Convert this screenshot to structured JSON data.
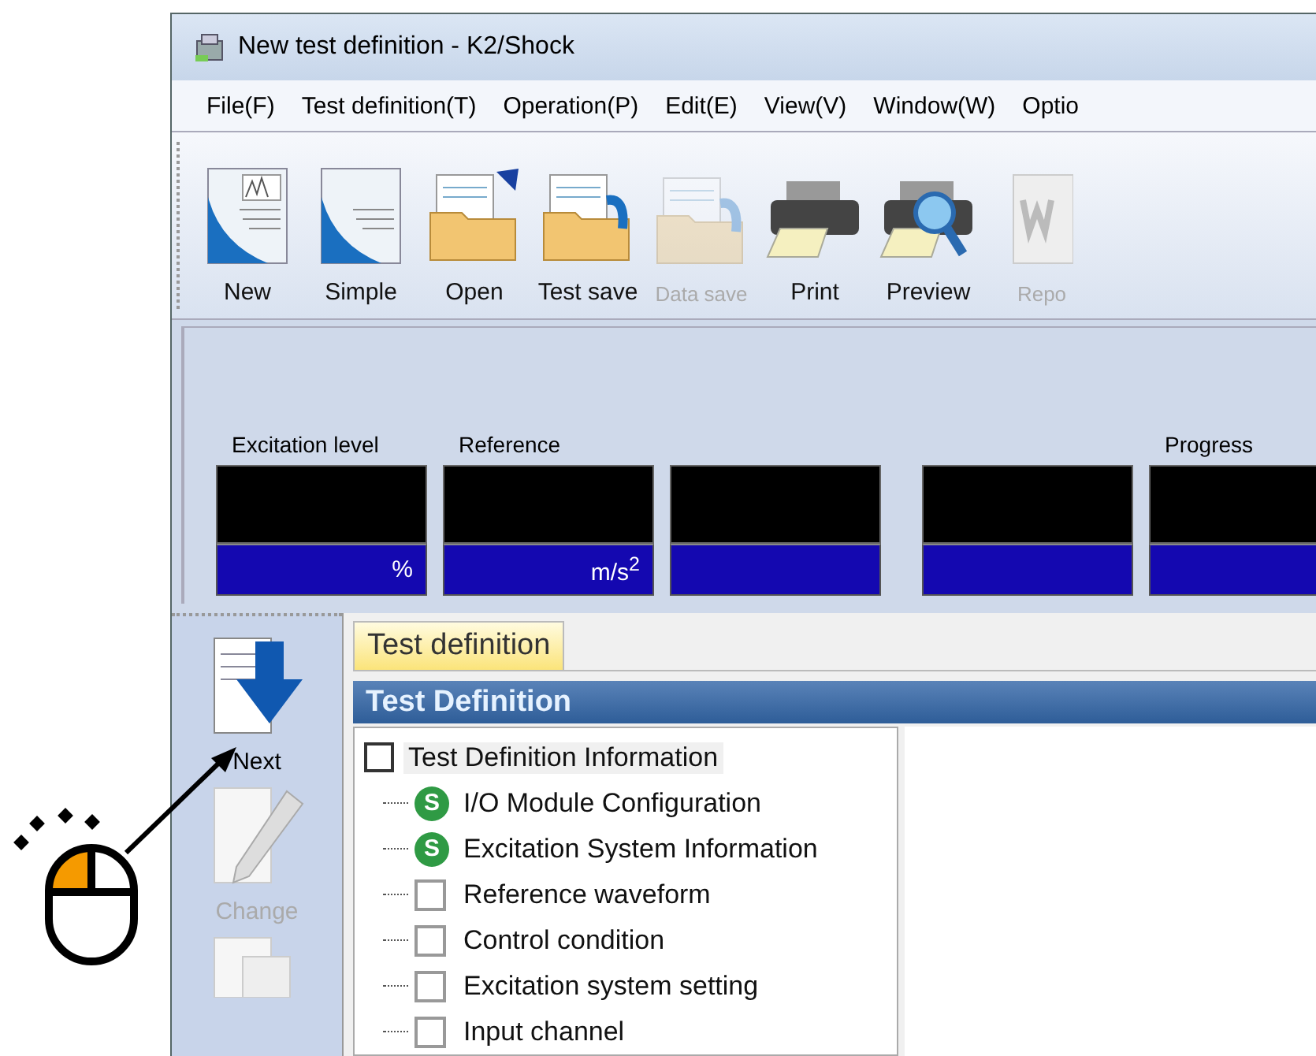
{
  "window": {
    "title": "New test definition - K2/Shock"
  },
  "menu": [
    "File(F)",
    "Test definition(T)",
    "Operation(P)",
    "Edit(E)",
    "View(V)",
    "Window(W)",
    "Optio"
  ],
  "toolbar": [
    {
      "kind": "new",
      "label": "New",
      "disabled": false
    },
    {
      "kind": "simple",
      "label": "Simple",
      "disabled": false
    },
    {
      "kind": "open",
      "label": "Open",
      "disabled": false
    },
    {
      "kind": "test-save",
      "label": "Test save",
      "disabled": false
    },
    {
      "kind": "data-save",
      "label": "Data save",
      "disabled": true
    },
    {
      "kind": "print",
      "label": "Print",
      "disabled": false
    },
    {
      "kind": "preview",
      "label": "Preview",
      "disabled": false
    },
    {
      "kind": "report",
      "label": "Repo",
      "disabled": true
    }
  ],
  "meters": [
    {
      "kind": "display",
      "label": "Excitation level",
      "unit": "%"
    },
    {
      "kind": "display",
      "label": "Reference",
      "unit": "m/s$^{2}$"
    },
    {
      "kind": "display"
    },
    {
      "kind": "display"
    },
    {
      "kind": "display",
      "label": "Progress"
    }
  ],
  "sidebar": [
    {
      "kind": "next",
      "label": "Next",
      "disabled": false
    },
    {
      "kind": "change",
      "label": "Change",
      "disabled": true
    },
    {
      "kind": "page"
    }
  ],
  "tabs": [
    {
      "label": "Test definition",
      "selected": true
    }
  ],
  "panel": {
    "title": "Test Definition",
    "tree": {
      "label": "Test Definition Information",
      "checked": false,
      "selected": true,
      "children": [
        {
          "kind": "status",
          "badge": "S",
          "label": "I/O Module Configuration",
          "selected": false
        },
        {
          "kind": "status",
          "badge": "S",
          "label": "Excitation System Information",
          "selected": false
        },
        {
          "kind": "checkbox",
          "checked": false,
          "label": "Reference waveform",
          "selected": false
        },
        {
          "kind": "checkbox",
          "checked": false,
          "label": "Control condition",
          "selected": false
        },
        {
          "kind": "checkbox",
          "checked": false,
          "label": "Excitation system setting",
          "selected": false
        },
        {
          "kind": "checkbox",
          "checked": false,
          "label": "Input channel",
          "selected": false
        }
      ]
    }
  }
}
